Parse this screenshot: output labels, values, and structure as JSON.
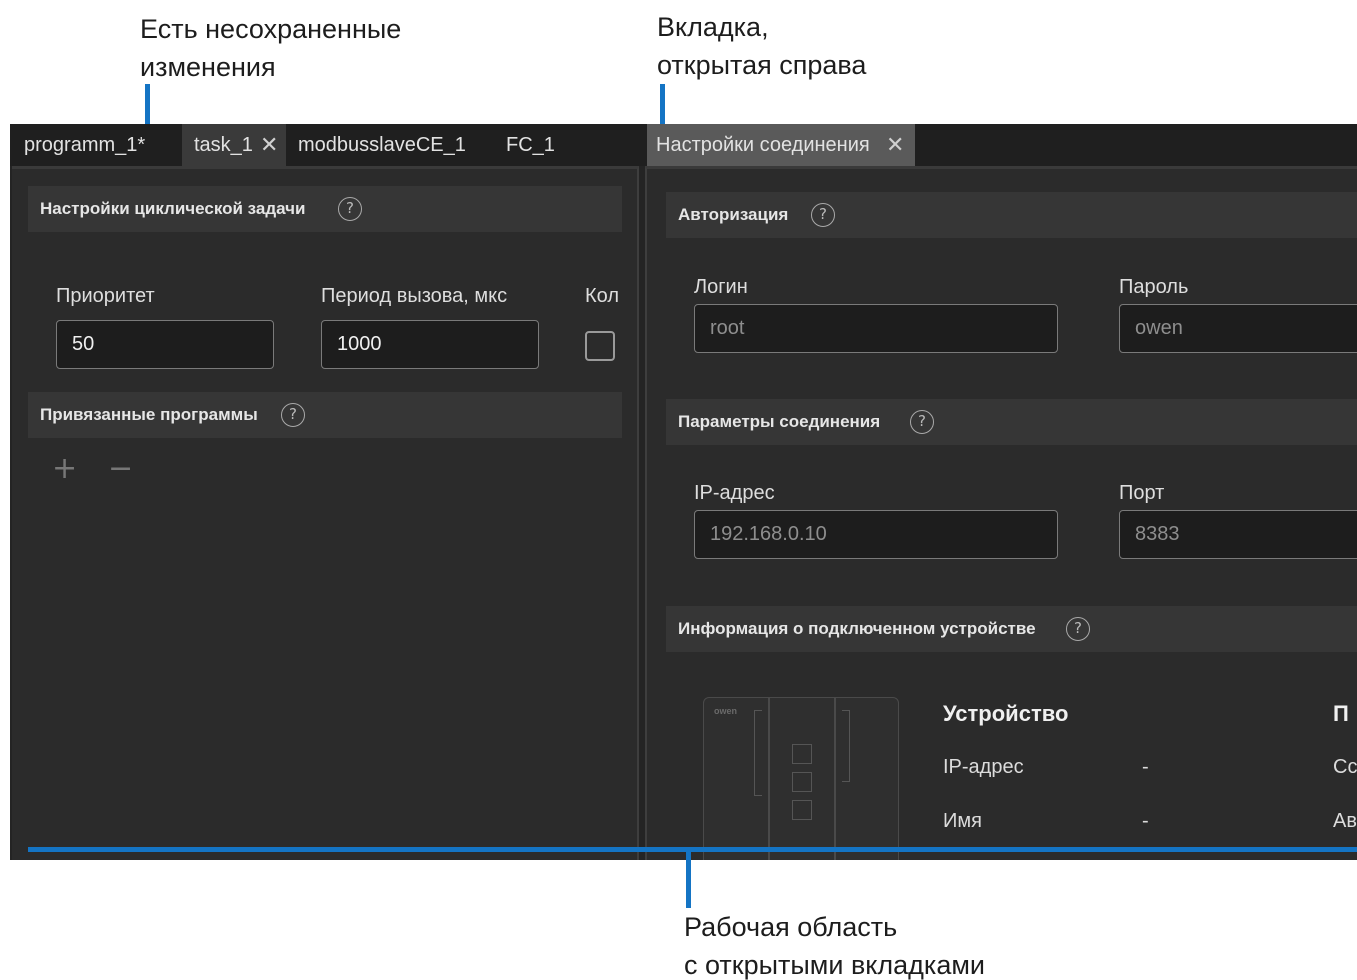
{
  "callouts": {
    "unsaved": "Есть несохраненные\nизменения",
    "right_tab": "Вкладка,\nоткрытая справа",
    "workspace": "Рабочая область\nс открытыми вкладками"
  },
  "tabs_left": [
    {
      "label": "programm_1*"
    },
    {
      "label": "task_1",
      "close": "✕"
    },
    {
      "label": "modbusslaveCE_1"
    },
    {
      "label": "FC_1"
    }
  ],
  "tabs_right": [
    {
      "label": "Настройки соединения",
      "close": "✕"
    }
  ],
  "left_panel": {
    "cyclic_section": "Настройки циклической задачи",
    "help_glyph": "?",
    "priority_label": "Приоритет",
    "priority_value": "50",
    "period_label": "Период вызова, мкс",
    "period_value": "1000",
    "count_label": "Кол",
    "programs_section": "Привязанные программы",
    "add_glyph": "+",
    "remove_glyph": "−"
  },
  "right_panel": {
    "auth_section": "Авторизация",
    "login_label": "Логин",
    "login_value": "root",
    "password_label": "Пароль",
    "password_value": "owen",
    "conn_section": "Параметры соединения",
    "ip_label": "IP-адрес",
    "ip_value": "192.168.0.10",
    "port_label": "Порт",
    "port_value": "8383",
    "device_section": "Информация о подключенном устройстве",
    "device_brand": "owen",
    "info_head": "Устройство",
    "info_head_2": "П",
    "rows": [
      {
        "label": "IP-адрес",
        "value": "-",
        "extra": "Сс"
      },
      {
        "label": "Имя",
        "value": "-",
        "extra": "Ав"
      }
    ]
  },
  "colors": {
    "accent": "#1474c4",
    "background": "#242424",
    "panel": "#2b2b2b",
    "section": "#363636"
  }
}
